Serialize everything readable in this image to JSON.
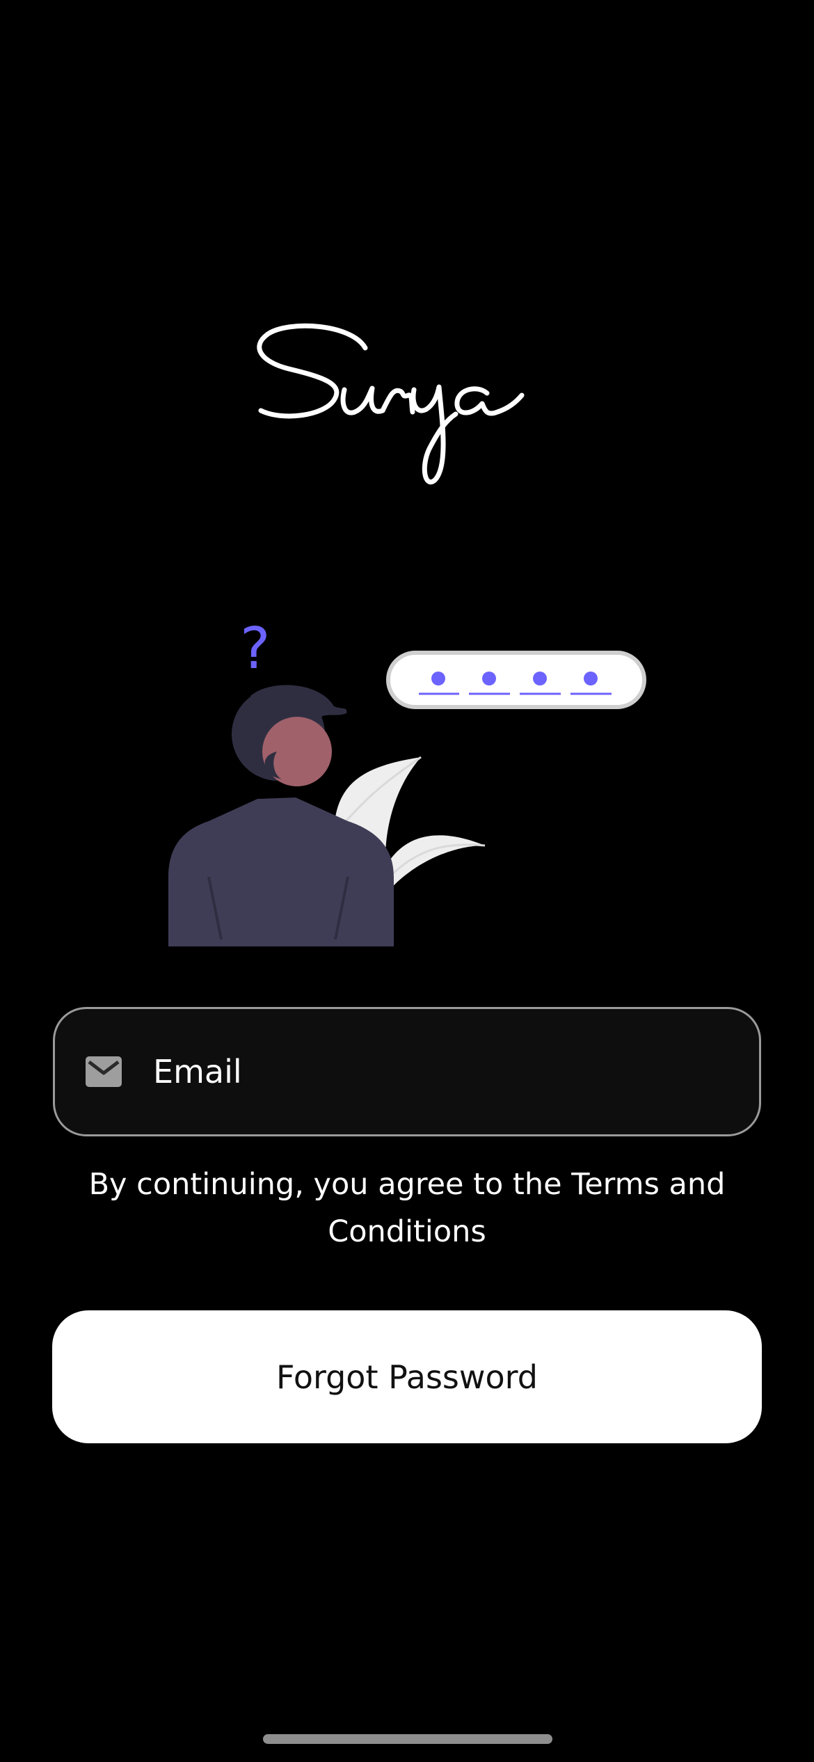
{
  "app": {
    "logo_text": "Surya"
  },
  "illustration": {
    "question_mark": "?"
  },
  "email_field": {
    "placeholder": "Email",
    "value": "",
    "icon": "mail-icon"
  },
  "terms": {
    "text": "By continuing, you agree to the Terms and Conditions"
  },
  "actions": {
    "forgot_password_label": "Forgot Password"
  },
  "colors": {
    "background": "#000000",
    "accent": "#6c63ff",
    "field_background": "#0e0e0e",
    "field_border": "#9a9a9a",
    "button_background": "#ffffff",
    "button_text": "#111111",
    "person_body": "#3f3d56",
    "person_hair": "#2f2e41",
    "person_skin": "#a0616a"
  }
}
